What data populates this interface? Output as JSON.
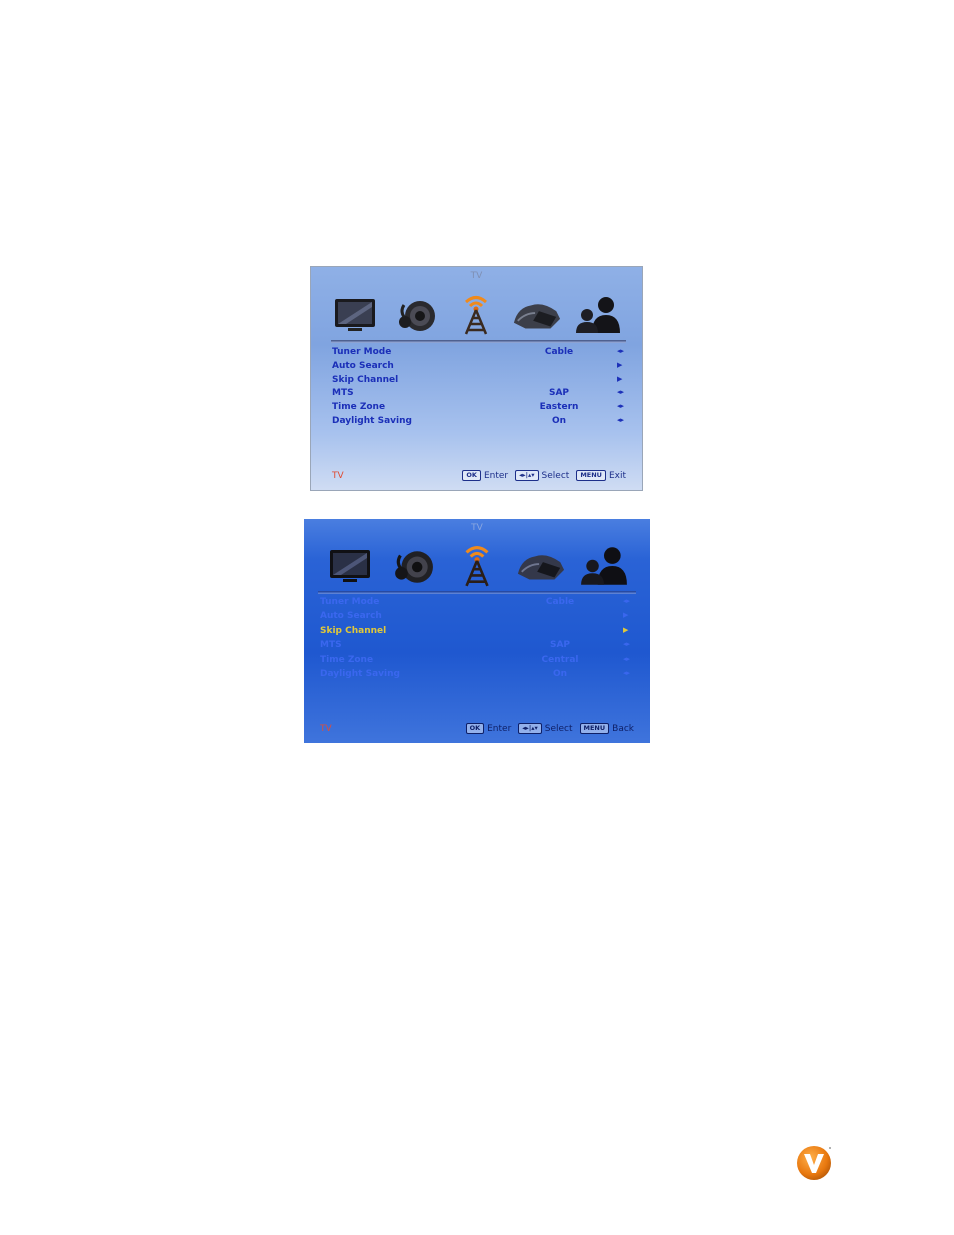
{
  "screen1": {
    "title": "TV",
    "icons": [
      "picture-icon",
      "audio-icon",
      "tv-antenna-icon",
      "setup-icon",
      "parental-icon"
    ],
    "rows": [
      {
        "label": "Tuner Mode",
        "value": "Cable",
        "arrow": "◂▸"
      },
      {
        "label": "Auto Search",
        "value": "",
        "arrow": "▶"
      },
      {
        "label": "Skip Channel",
        "value": "",
        "arrow": "▶"
      },
      {
        "label": "MTS",
        "value": "SAP",
        "arrow": "◂▸"
      },
      {
        "label": "Time Zone",
        "value": "Eastern",
        "arrow": "◂▸"
      },
      {
        "label": "Daylight Saving",
        "value": "On",
        "arrow": "◂▸"
      }
    ],
    "footer": {
      "source": "TV",
      "ok_key": "OK",
      "ok_text": "Enter",
      "nav_key": "◂▸|▴▾",
      "nav_text": "Select",
      "menu_key": "MENU",
      "menu_text": "Exit"
    }
  },
  "screen2": {
    "title": "TV",
    "selected_row": 2,
    "rows": [
      {
        "label": "Tuner Mode",
        "value": "Cable",
        "arrow": "◂▸"
      },
      {
        "label": "Auto Search",
        "value": "",
        "arrow": "▶"
      },
      {
        "label": "Skip Channel",
        "value": "",
        "arrow": "▶"
      },
      {
        "label": "MTS",
        "value": "SAP",
        "arrow": "◂▸"
      },
      {
        "label": "Time Zone",
        "value": "Central",
        "arrow": "◂▸"
      },
      {
        "label": "Daylight Saving",
        "value": "On",
        "arrow": "◂▸"
      }
    ],
    "footer": {
      "source": "TV",
      "ok_key": "OK",
      "ok_text": "Enter",
      "nav_key": "◂▸|▴▾",
      "nav_text": "Select",
      "menu_key": "MENU",
      "menu_text": "Back"
    }
  },
  "colors": {
    "accent_orange": "#f08a1c",
    "highlight": "#e0c83a"
  }
}
